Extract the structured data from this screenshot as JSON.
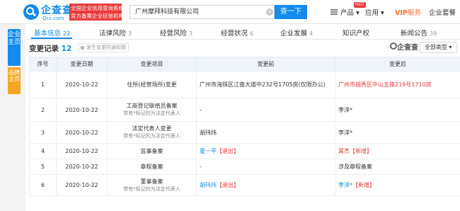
{
  "header": {
    "logo_name": "企查查",
    "logo_domain": "Qcc.com",
    "slogan_line1": "全国企业信用查询系统",
    "slogan_line2": "官方备案企业征信机构",
    "search_value": "广州摩拜科技有限公司",
    "search_button": "查一下",
    "nav": {
      "product": "产品",
      "product_badge": "HOT",
      "apps": "应用",
      "vip": "VIP",
      "vip_suffix": "服务",
      "enterprise": "企业套餐"
    }
  },
  "side": {
    "main_label": "企业主页",
    "brand_label": "品牌主页"
  },
  "tabs": [
    {
      "label": "基本信息",
      "count": "22"
    },
    {
      "label": "法律风险",
      "count": "3"
    },
    {
      "label": "经营风险",
      "count": "3"
    },
    {
      "label": "经营状况",
      "count": "6"
    },
    {
      "label": "企业发展",
      "count": "4"
    },
    {
      "label": "知识产权",
      "count": ""
    },
    {
      "label": "新闻公告",
      "count": "39"
    }
  ],
  "section": {
    "title": "变更记录",
    "count": "12",
    "note": "发生变更时通知我",
    "watermark": "企查查",
    "type_select": "全部类型"
  },
  "table": {
    "headers": [
      "序号",
      "变更日期",
      "变更项目",
      "变更前",
      "变更后"
    ],
    "rows": [
      {
        "no": "1",
        "date": "2020-10-22",
        "item": "住所(经营场所)变更",
        "item_sub": "",
        "before": "广州市海珠区江南大道中232号1705房(仅限办公)",
        "after": "广州市越秀区中山五路219号1710房"
      },
      {
        "no": "2",
        "date": "2020-10-22",
        "item": "工商登记联络员备案",
        "item_sub": "带有*标记的为法定代表人",
        "before": "-",
        "after": "李洋*"
      },
      {
        "no": "3",
        "date": "2020-10-22",
        "item": "法定代表人变更",
        "item_sub": "带有*标记的为法定代表人",
        "before": "胡玮炜",
        "after": "李洋*"
      },
      {
        "no": "4",
        "date": "2020-10-22",
        "item": "监事备案",
        "item_sub": "",
        "before_name": "夏一平",
        "before_tag": "【退出】",
        "after_name": "蒿杰",
        "after_tag": "【新增】"
      },
      {
        "no": "5",
        "date": "2020-10-22",
        "item": "章程备案",
        "item_sub": "",
        "before": "-",
        "after": "涉及章程备案"
      },
      {
        "no": "6",
        "date": "2020-10-22",
        "item": "董事备案",
        "item_sub": "带有*标记的为法定代表人",
        "before_name": "胡玮炜",
        "before_tag": "【退出】",
        "after_name": "李洋*",
        "after_tag": "【新增】"
      }
    ]
  },
  "colors": {
    "brand_blue": "#128bed",
    "highlight_red": "#e83b3b",
    "vip_orange": "#ff6b2b",
    "brand_tab_orange": "#f5a623"
  }
}
